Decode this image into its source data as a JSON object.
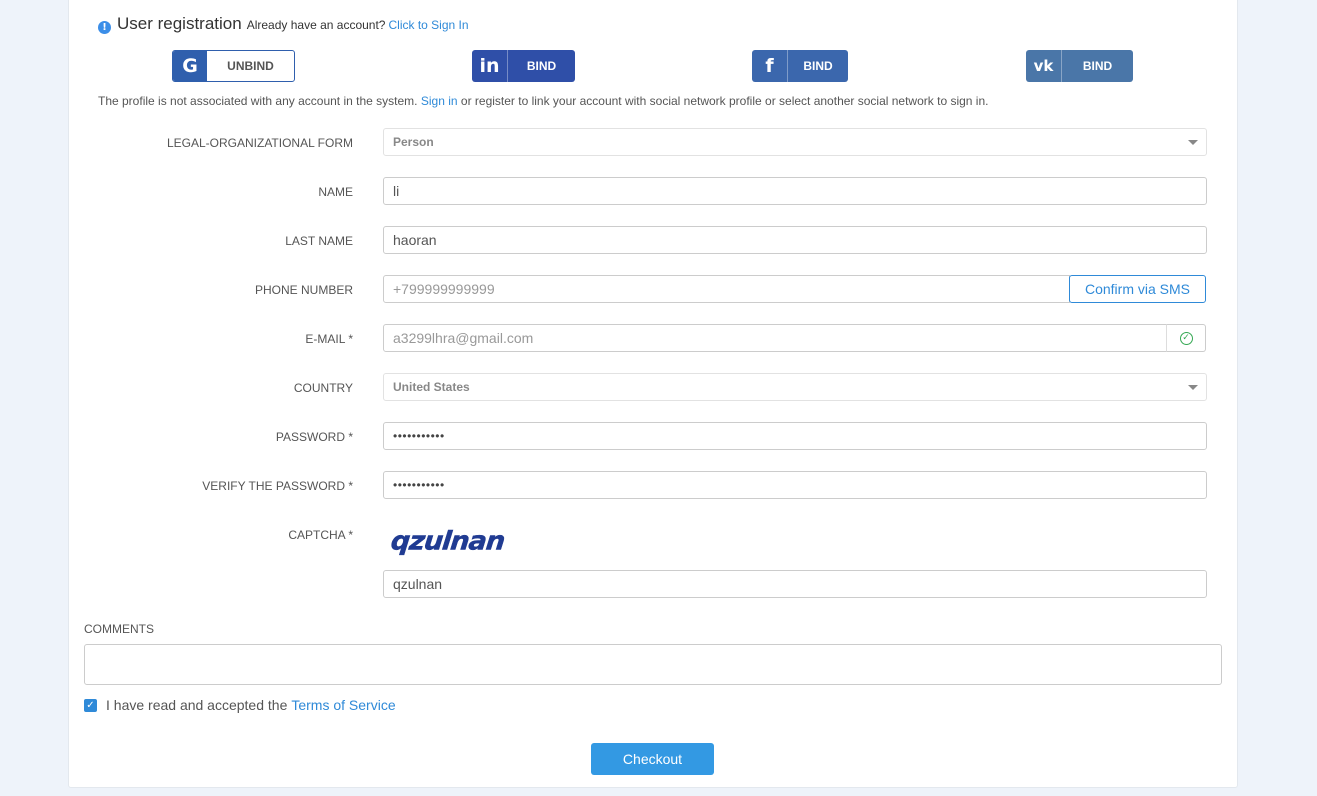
{
  "header": {
    "title": "User registration",
    "already_text": "Already have an account?",
    "signin_link": "Click to Sign In"
  },
  "social": {
    "google": {
      "icon": "G",
      "label": "UNBIND"
    },
    "linkedin": {
      "icon": "in",
      "label": "BIND"
    },
    "facebook": {
      "icon": "f",
      "label": "BIND"
    },
    "vk": {
      "icon": "vk",
      "label": "BIND"
    }
  },
  "note": {
    "before": "The profile is not associated with any account in the system.",
    "link": "Sign in",
    "after": "or register to link your account with social network profile or select another social network to sign in."
  },
  "form": {
    "legal_form": {
      "label": "LEGAL-ORGANIZATIONAL FORM",
      "value": "Person"
    },
    "name": {
      "label": "NAME",
      "value": "li"
    },
    "last_name": {
      "label": "LAST NAME",
      "value": "haoran"
    },
    "phone": {
      "label": "PHONE NUMBER",
      "placeholder": "+799999999999",
      "button": "Confirm via SMS"
    },
    "email": {
      "label": "E-MAIL *",
      "value": "a3299lhra@gmail.com"
    },
    "country": {
      "label": "COUNTRY",
      "value": "United States"
    },
    "password": {
      "label": "PASSWORD *",
      "value": "•••••••••••"
    },
    "verify_password": {
      "label": "VERIFY THE PASSWORD *",
      "value": "•••••••••••"
    },
    "captcha": {
      "label": "CAPTCHA *",
      "image_text": "qzulnan",
      "value": "qzulnan"
    }
  },
  "comments": {
    "label": "COMMENTS",
    "value": ""
  },
  "terms": {
    "text": "I have read and accepted the",
    "link": "Terms of Service",
    "checked": true
  },
  "checkout_label": "Checkout",
  "colors": {
    "accent": "#3399e3",
    "link": "#2f8ad8",
    "google": "#2f5fad",
    "linkedin": "#2f4fa8",
    "facebook": "#3b67ad",
    "vk": "#4a76a8"
  }
}
